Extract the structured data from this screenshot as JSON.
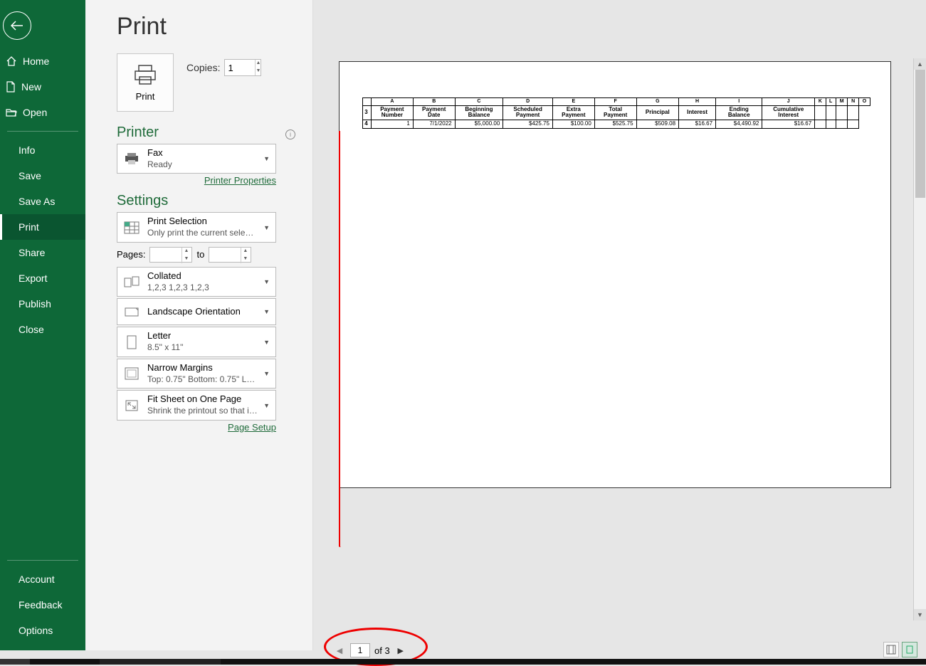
{
  "sidebar": {
    "items_top": [
      {
        "label": "Home",
        "icon": "home"
      },
      {
        "label": "New",
        "icon": "new"
      },
      {
        "label": "Open",
        "icon": "open"
      }
    ],
    "items_mid": [
      {
        "label": "Info"
      },
      {
        "label": "Save"
      },
      {
        "label": "Save As"
      },
      {
        "label": "Print",
        "selected": true
      },
      {
        "label": "Share"
      },
      {
        "label": "Export"
      },
      {
        "label": "Publish"
      },
      {
        "label": "Close"
      }
    ],
    "items_bottom": [
      {
        "label": "Account"
      },
      {
        "label": "Feedback"
      },
      {
        "label": "Options"
      }
    ]
  },
  "page_title": "Print",
  "print_button": "Print",
  "copies": {
    "label": "Copies:",
    "value": "1"
  },
  "printer_section": {
    "title": "Printer",
    "name": "Fax",
    "status": "Ready",
    "properties_link": "Printer Properties"
  },
  "settings_section": {
    "title": "Settings",
    "print_what": {
      "line1": "Print Selection",
      "line2": "Only print the current selecti..."
    },
    "pages": {
      "label": "Pages:",
      "to": "to",
      "from": "",
      "until": ""
    },
    "collation": {
      "line1": "Collated",
      "line2": "1,2,3    1,2,3    1,2,3"
    },
    "orientation": {
      "line1": "Landscape Orientation"
    },
    "paper": {
      "line1": "Letter",
      "line2": "8.5\" x 11\""
    },
    "margins": {
      "line1": "Narrow Margins",
      "line2": "Top: 0.75\" Bottom: 0.75\" Lef..."
    },
    "scaling": {
      "line1": "Fit Sheet on One Page",
      "line2": "Shrink the printout so that it..."
    },
    "page_setup_link": "Page Setup"
  },
  "preview": {
    "columns": [
      "A",
      "B",
      "C",
      "D",
      "E",
      "F",
      "G",
      "H",
      "I",
      "J",
      "K",
      "L",
      "M",
      "N",
      "O"
    ],
    "headers": [
      "",
      "Payment Number",
      "Payment Date",
      "Beginning Balance",
      "Scheduled Payment",
      "Extra Payment",
      "Total Payment",
      "Principal",
      "Interest",
      "Ending Balance",
      "Cumulative Interest",
      "",
      "",
      "",
      ""
    ],
    "row3": "3",
    "row4": "4",
    "data": [
      "1",
      "7/1/2022",
      "$5,000.00",
      "$425.75",
      "$100.00",
      "$525.75",
      "$509.08",
      "$16.67",
      "$4,490.92",
      "$16.67"
    ]
  },
  "pager": {
    "current": "1",
    "of_text": "of 3"
  }
}
